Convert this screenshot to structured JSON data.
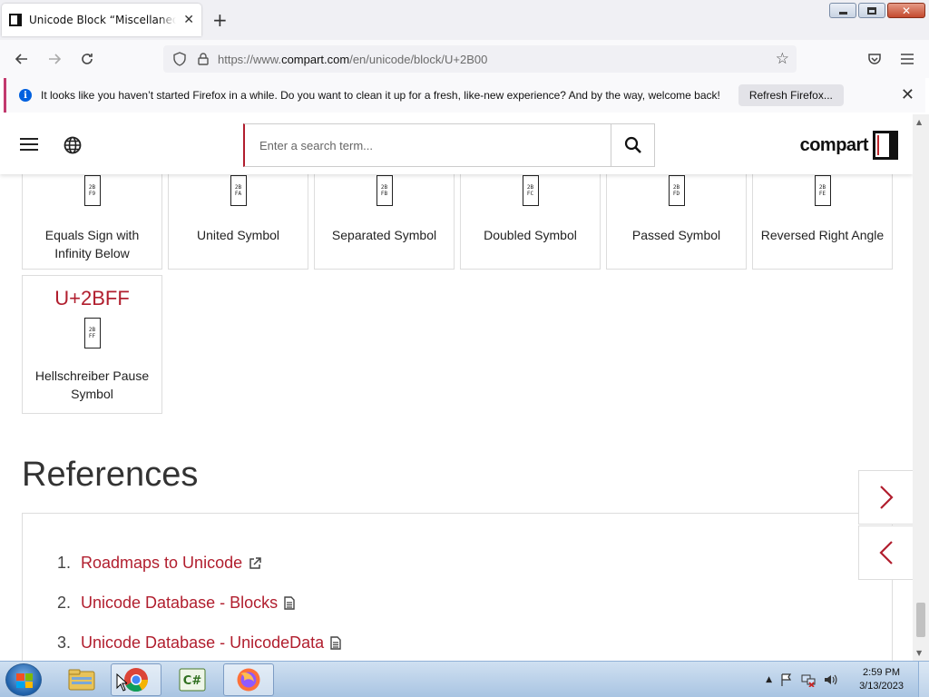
{
  "browser": {
    "tab_title": "Unicode Block “Miscellaneous Symbols and Arrows”",
    "url_domain": "compart.com",
    "url_prefix": "https://www.",
    "url_path": "/en/unicode/block/U+2B00"
  },
  "notification": {
    "message": "It looks like you haven’t started Firefox in a while. Do you want to clean it up for a fresh, like-new experience? And by the way, welcome back!",
    "button_label": "Refresh Firefox..."
  },
  "site": {
    "search_placeholder": "Enter a search term...",
    "logo_text": "compart"
  },
  "characters": [
    {
      "name": "Equals Sign with Infinity Below",
      "hex": [
        "2B",
        "F9"
      ]
    },
    {
      "name": "United Symbol",
      "hex": [
        "2B",
        "FA"
      ]
    },
    {
      "name": "Separated Symbol",
      "hex": [
        "2B",
        "FB"
      ]
    },
    {
      "name": "Doubled Symbol",
      "hex": [
        "2B",
        "FC"
      ]
    },
    {
      "name": "Passed Symbol",
      "hex": [
        "2B",
        "FD"
      ]
    },
    {
      "name": "Reversed Right Angle",
      "hex": [
        "2B",
        "FE"
      ]
    },
    {
      "code": "U+2BFF",
      "name": "Hellschreiber Pause Symbol",
      "hex": [
        "2B",
        "FF"
      ]
    }
  ],
  "references": {
    "title": "References",
    "items": [
      {
        "num": "1.",
        "label": "Roadmaps to Unicode",
        "icon": "external-link-icon"
      },
      {
        "num": "2.",
        "label": "Unicode Database - Blocks",
        "icon": "document-icon"
      },
      {
        "num": "3.",
        "label": "Unicode Database - UnicodeData",
        "icon": "document-icon"
      }
    ]
  },
  "taskbar": {
    "time": "2:59 PM",
    "date": "3/13/2023",
    "apps": [
      "file-explorer-icon",
      "chrome-icon",
      "csharp-icon",
      "firefox-icon"
    ]
  },
  "colors": {
    "accent": "#b11e2e",
    "notice_border": "#c23a6e",
    "info_blue": "#0060df"
  }
}
